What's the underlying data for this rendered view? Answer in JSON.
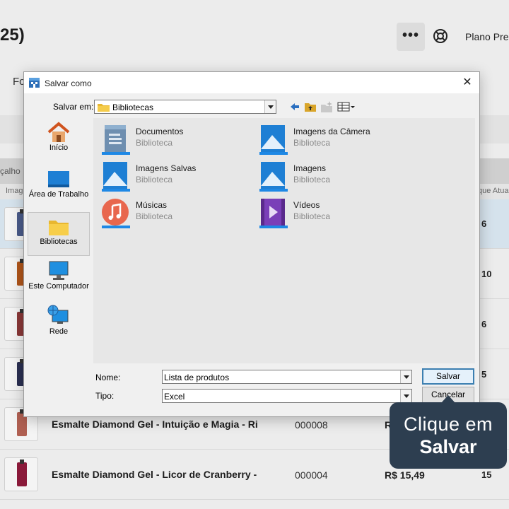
{
  "background": {
    "title_fragment": "25)",
    "more_button": "•••",
    "plan_label": "Plano Pre",
    "filter_fragment": "Fo",
    "table_header_fragment": "çalho",
    "subheader_left": "Imag",
    "subheader_right": "que Atua",
    "rows": [
      {
        "qty": "6",
        "selected": true,
        "color": "#4a5b8a"
      },
      {
        "qty": "10",
        "selected": false,
        "color": "#b0551a"
      },
      {
        "qty": "6",
        "selected": false,
        "color": "#8a3838"
      },
      {
        "qty": "5",
        "selected": false,
        "color": "#2a2f52"
      },
      {
        "name": "Esmalte Diamond Gel - Intuição e Magia - Ri",
        "code": "000008",
        "price": "R$",
        "qty": "",
        "selected": false,
        "color": "#b06052"
      },
      {
        "name": "Esmalte Diamond Gel - Licor de Cranberry -",
        "code": "000004",
        "price": "R$ 15,49",
        "qty": "15",
        "selected": false,
        "color": "#8a1a3a"
      }
    ]
  },
  "dialog": {
    "title": "Salvar como",
    "save_in_label": "Salvar em:",
    "save_in_value": "Bibliotecas",
    "places": [
      {
        "label": "Início",
        "icon": "home-icon"
      },
      {
        "label": "Área de Trabalho",
        "icon": "desktop-icon"
      },
      {
        "label": "Bibliotecas",
        "icon": "libraries-icon"
      },
      {
        "label": "Este Computador",
        "icon": "computer-icon"
      },
      {
        "label": "Rede",
        "icon": "network-icon"
      }
    ],
    "items": [
      {
        "name": "Documentos",
        "type": "Biblioteca",
        "icon": "documents-library-icon"
      },
      {
        "name": "Imagens da Câmera",
        "type": "Biblioteca",
        "icon": "camera-roll-library-icon"
      },
      {
        "name": "Imagens Salvas",
        "type": "Biblioteca",
        "icon": "saved-pictures-library-icon"
      },
      {
        "name": "Imagens",
        "type": "Biblioteca",
        "icon": "pictures-library-icon"
      },
      {
        "name": "Músicas",
        "type": "Biblioteca",
        "icon": "music-library-icon"
      },
      {
        "name": "Vídeos",
        "type": "Biblioteca",
        "icon": "videos-library-icon"
      }
    ],
    "filename_label": "Nome:",
    "filename_value": "Lista de produtos",
    "filetype_label": "Tipo:",
    "filetype_value": "Excel",
    "save_button": "Salvar",
    "cancel_button": "Cancelar"
  },
  "tooltip": {
    "line1": "Clique em",
    "line2": "Salvar"
  },
  "colors": {
    "accent": "#3c7fb1",
    "tooltip_bg": "#2d3e50"
  }
}
